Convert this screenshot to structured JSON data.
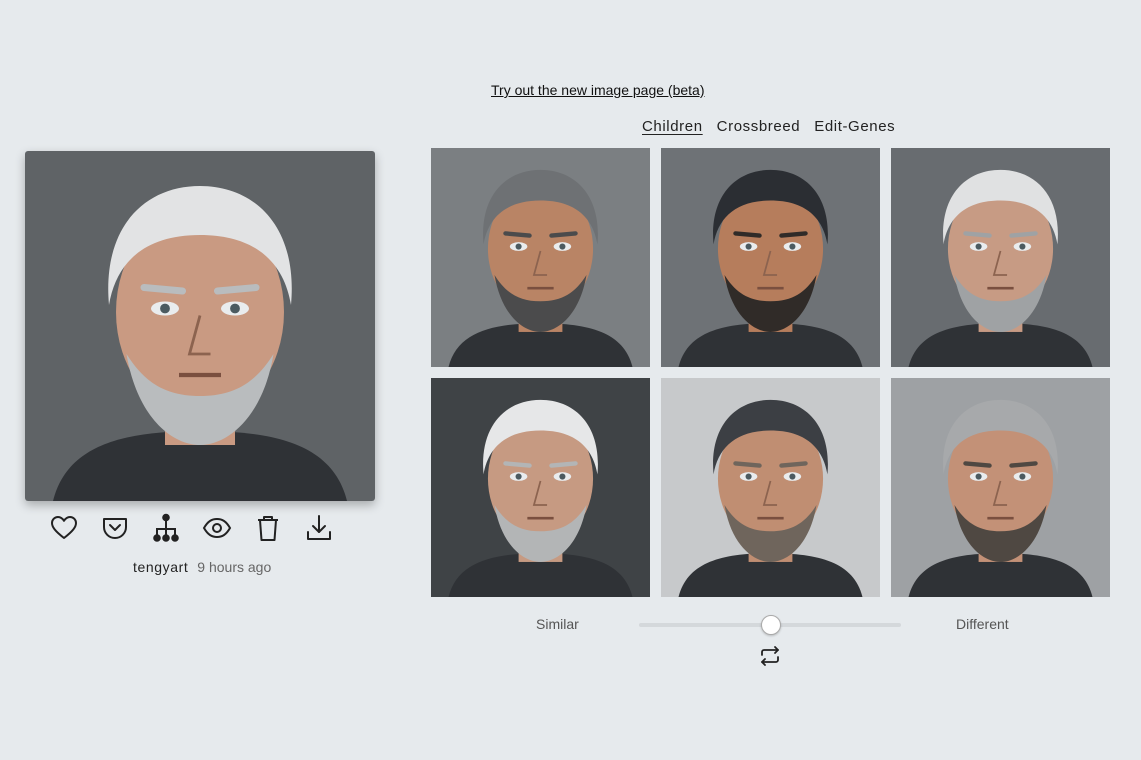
{
  "beta_link": "Try out the new image page (beta)",
  "tabs": [
    {
      "label": "Children",
      "active": true
    },
    {
      "label": "Crossbreed",
      "active": false
    },
    {
      "label": "Edit-Genes",
      "active": false
    }
  ],
  "main_image": {
    "hair": "#e2e3e4",
    "beard": "#b9bcbe",
    "skin": "#c99a82",
    "bg": "#5f6366"
  },
  "actions": [
    {
      "icon": "heart-icon"
    },
    {
      "icon": "pocket-icon"
    },
    {
      "icon": "family-tree-icon"
    },
    {
      "icon": "eye-icon"
    },
    {
      "icon": "trash-icon"
    },
    {
      "icon": "download-icon"
    }
  ],
  "author": "tengyart",
  "timestamp": "9 hours ago",
  "children": [
    {
      "hair": "#6e7174",
      "beard": "#4b4b4c",
      "skin": "#b98465",
      "bg": "#7b7f82"
    },
    {
      "hair": "#2b2e33",
      "beard": "#302b28",
      "skin": "#b67d5c",
      "bg": "#6e7276"
    },
    {
      "hair": "#e0e1e2",
      "beard": "#9fa2a4",
      "skin": "#c79b84",
      "bg": "#686c70"
    },
    {
      "hair": "#e6e7e8",
      "beard": "#b3b5b6",
      "skin": "#c69a82",
      "bg": "#3f4346"
    },
    {
      "hair": "#3c3f44",
      "beard": "#6f655c",
      "skin": "#c08e72",
      "bg": "#c7c9cb"
    },
    {
      "hair": "#a7a9ab",
      "beard": "#4f4842",
      "skin": "#c39177",
      "bg": "#9ea1a4"
    }
  ],
  "slider": {
    "left_label": "Similar",
    "right_label": "Different",
    "value": 0.5
  },
  "swap_icon": "swap-arrows-icon"
}
